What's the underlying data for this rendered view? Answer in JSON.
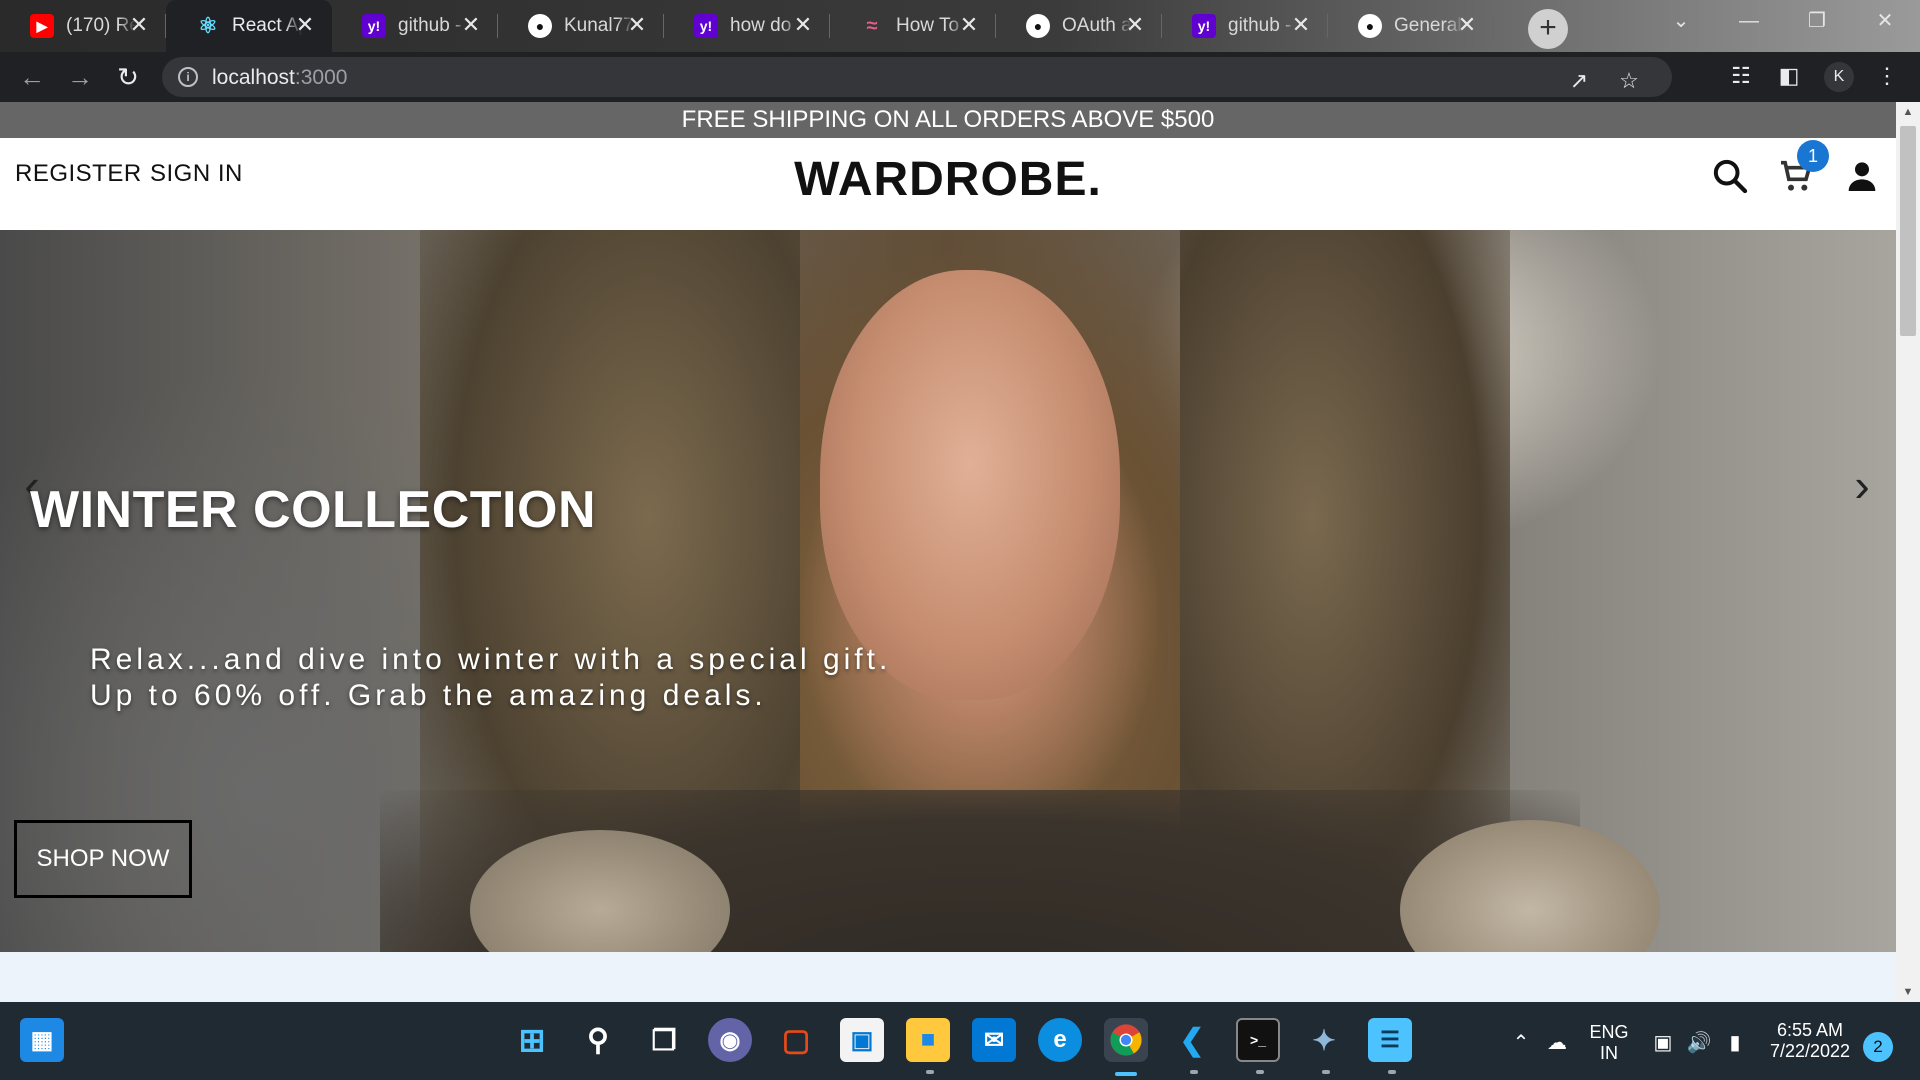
{
  "browser": {
    "tabs": [
      {
        "title": "(170) Re",
        "favicon": "youtube-icon",
        "active": false
      },
      {
        "title": "React Ap",
        "favicon": "react-icon",
        "active": true
      },
      {
        "title": "github -",
        "favicon": "yahoo-icon",
        "active": false
      },
      {
        "title": "Kunal77",
        "favicon": "github-icon",
        "active": false
      },
      {
        "title": "how do",
        "favicon": "yahoo-icon",
        "active": false
      },
      {
        "title": "How To",
        "favicon": "stackoverflow-icon",
        "active": false
      },
      {
        "title": "OAuth a",
        "favicon": "github-icon",
        "active": false
      },
      {
        "title": "github -",
        "favicon": "yahoo-icon",
        "active": false
      },
      {
        "title": "General",
        "favicon": "github-icon",
        "active": false
      }
    ],
    "url_host": "localhost",
    "url_port": ":3000",
    "profile_initial": "K"
  },
  "site": {
    "announcement": "FREE SHIPPING ON ALL ORDERS ABOVE $500",
    "nav": {
      "register": "REGISTER",
      "sign_in": "SIGN IN"
    },
    "logo": "WARDROBE.",
    "cart_count": "1"
  },
  "hero": {
    "title": "WINTER COLLECTION",
    "line1": "Relax...and dive into winter with a special gift.",
    "line2": "Up to 60% off. Grab the amazing deals.",
    "cta": "SHOP NOW"
  },
  "taskbar": {
    "lang_top": "ENG",
    "lang_bottom": "IN",
    "time": "6:55 AM",
    "date": "7/22/2022",
    "notifications": "2"
  },
  "colors": {
    "announcement_bg": "#666666",
    "cart_badge": "#1976d2",
    "taskbar_bg": "#202a33"
  }
}
